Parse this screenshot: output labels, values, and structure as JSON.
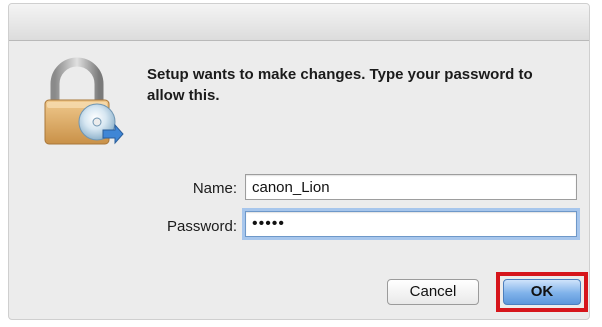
{
  "dialog": {
    "message": "Setup wants to make changes. Type your password to allow this.",
    "icon": "padlock-with-installer-disc-icon",
    "fields": {
      "name_label": "Name:",
      "name_value": "canon_Lion",
      "password_label": "Password:",
      "password_masked": "•••••"
    },
    "buttons": {
      "cancel": "Cancel",
      "ok": "OK"
    },
    "colors": {
      "highlight": "#d6151b",
      "ok_button": "#7fb2ea",
      "focus_ring": "#a7c6ec"
    }
  }
}
